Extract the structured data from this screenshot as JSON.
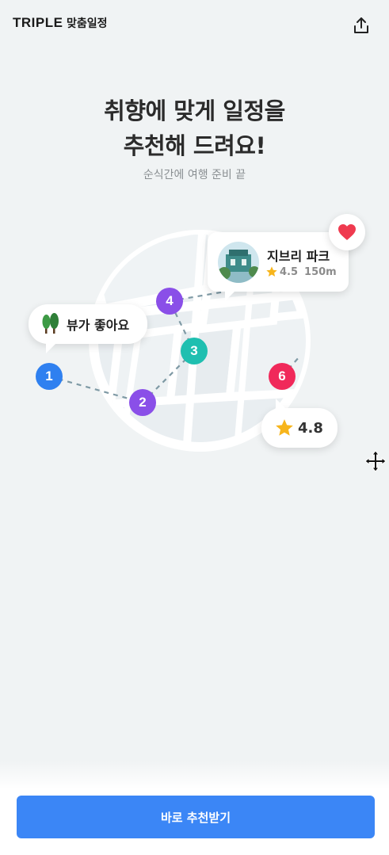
{
  "header": {
    "brand": "TRIPLE",
    "subtitle": "맞춤일정",
    "share_icon": "share-upload-icon"
  },
  "hero": {
    "title_line1": "취향에 맞게 일정을",
    "title_line2": "추천해 드려요!",
    "subtitle": "순식간에 여행 준비 끝"
  },
  "illustration": {
    "view_bubble": {
      "icon": "tree-icon",
      "label": "뷰가 좋아요"
    },
    "place_card": {
      "name": "지브리 파크",
      "rating": "4.5",
      "distance": "150m",
      "favorite_icon": "heart-icon"
    },
    "rating_bubble": {
      "icon": "star-icon",
      "value": "4.8"
    },
    "pins": [
      {
        "label": "1",
        "color": "#2f80f0"
      },
      {
        "label": "2",
        "color": "#8a4fe8"
      },
      {
        "label": "3",
        "color": "#1fbfb0"
      },
      {
        "label": "4",
        "color": "#8a4fe8"
      },
      {
        "label": "6",
        "color": "#f0295a"
      }
    ]
  },
  "cta": {
    "label": "바로 추천받기",
    "color": "#3b86f6"
  },
  "colors": {
    "background": "#f0f3f4",
    "heart": "#ef3a4f",
    "star": "#f7b51c"
  }
}
